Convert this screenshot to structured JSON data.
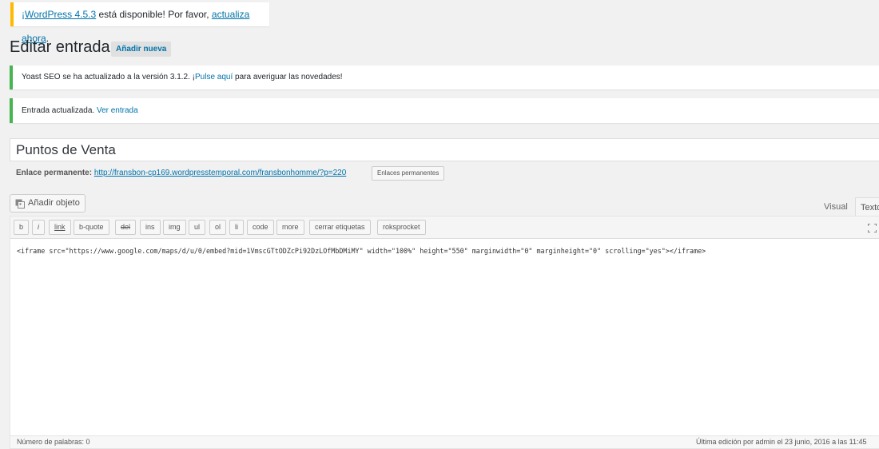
{
  "update_nag": {
    "link1": "¡WordPress 4.5.3",
    "middle": " está disponible! Por favor, ",
    "link2": "actualiza ahora",
    "end": "."
  },
  "header": {
    "title": "Editar entrada",
    "add_new": "Añadir nueva"
  },
  "notices": {
    "yoast_text": "Yoast SEO se ha actualizado a la versión 3.1.2. ¡",
    "yoast_link": "Pulse aquí",
    "yoast_end": " para averiguar las novedades!",
    "updated_text": "Entrada actualizada. ",
    "updated_link": "Ver entrada"
  },
  "post": {
    "title": "Puntos de Venta",
    "permalink_label": "Enlace permanente:",
    "permalink_url": "http://fransbon-cp169.wordpresstemporal.com/fransbonhomme/?p=220",
    "permalink_button": "Enlaces permanentes"
  },
  "media": {
    "add_media": "Añadir objeto",
    "icon": "media-icon"
  },
  "tabs": {
    "visual": "Visual",
    "text": "Texto"
  },
  "toolbar": {
    "buttons": [
      "b",
      "i",
      "link",
      "b-quote",
      "del",
      "ins",
      "img",
      "ul",
      "ol",
      "li",
      "code",
      "more",
      "cerrar etiquetas",
      "roksprocket"
    ]
  },
  "editor": {
    "content": "<iframe src=\"https://www.google.com/maps/d/u/0/embed?mid=1VmscGTtODZcPi92DzLOfMbDMiMY\" width=\"100%\" height=\"550\" marginwidth=\"0\" marginheight=\"0\" scrolling=\"yes\"></iframe>"
  },
  "status": {
    "word_count": "Número de palabras: 0",
    "last_edit": "Última edición por admin el 23 junio, 2016 a las 11:45"
  },
  "colors": {
    "link": "#0073aa",
    "warning": "#ffba00",
    "success": "#46b450"
  }
}
